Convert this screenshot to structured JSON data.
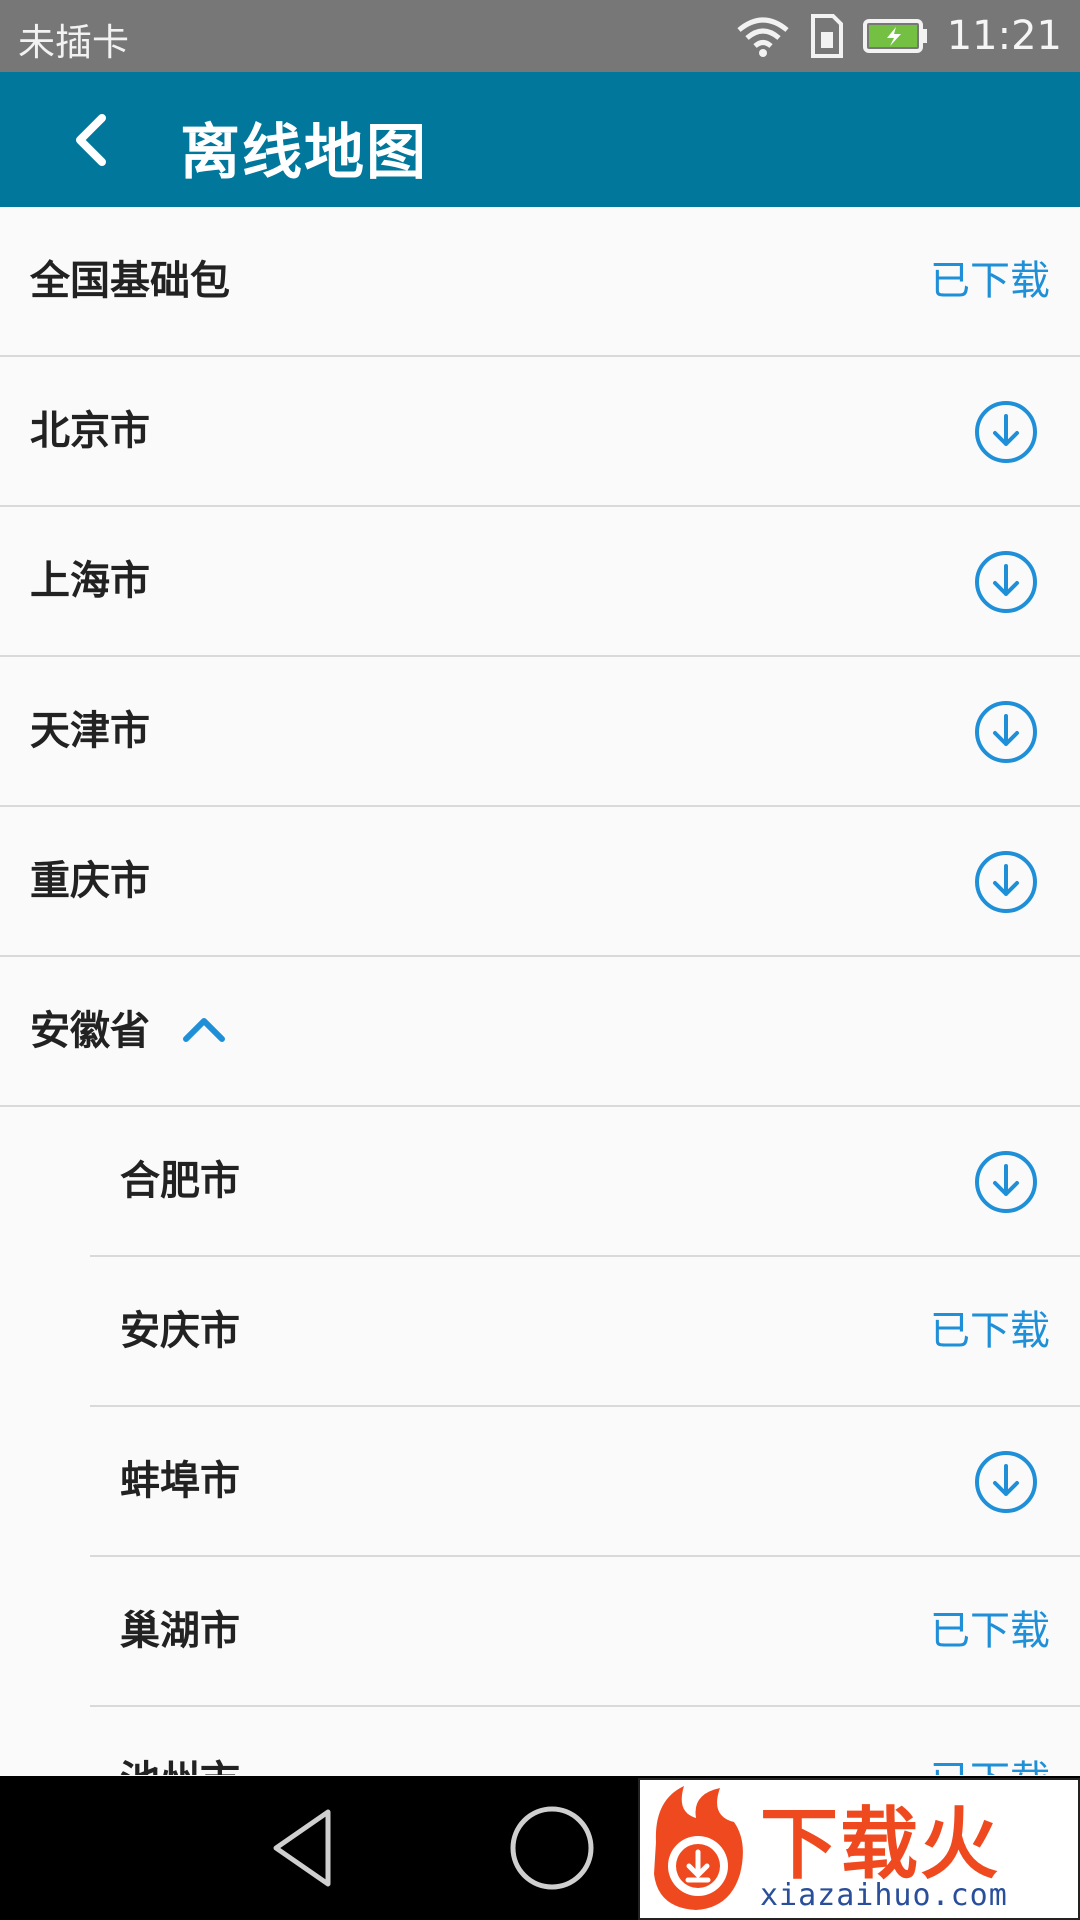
{
  "status_bar": {
    "carrier": "未插卡",
    "time": "11:21",
    "icons": [
      "wifi-icon",
      "sim-icon",
      "battery-charging-icon"
    ]
  },
  "app_bar": {
    "title": "离线地图",
    "back_icon": "back-arrow-icon"
  },
  "colors": {
    "app_bar": "#00779b",
    "accent": "#1f8fd8",
    "status_bar": "#777777"
  },
  "list": {
    "items": [
      {
        "label": "全国基础包",
        "status": "已下载"
      },
      {
        "label": "北京市",
        "action": "download-icon"
      },
      {
        "label": "上海市",
        "action": "download-icon"
      },
      {
        "label": "天津市",
        "action": "download-icon"
      },
      {
        "label": "重庆市",
        "action": "download-icon"
      },
      {
        "label": "安徽省",
        "expanded": true
      },
      {
        "label": "合肥市",
        "action": "download-icon",
        "child": true
      },
      {
        "label": "安庆市",
        "status": "已下载",
        "child": true
      },
      {
        "label": "蚌埠市",
        "action": "download-icon",
        "child": true
      },
      {
        "label": "巢湖市",
        "status": "已下载",
        "child": true
      },
      {
        "label": "池州市",
        "status": "已下载",
        "child": true
      }
    ]
  },
  "nav_bar": {
    "icons": [
      "nav-back-icon",
      "nav-home-icon"
    ]
  },
  "watermark": {
    "logo_text": "下载火",
    "url": "xiazaihuo.com"
  }
}
